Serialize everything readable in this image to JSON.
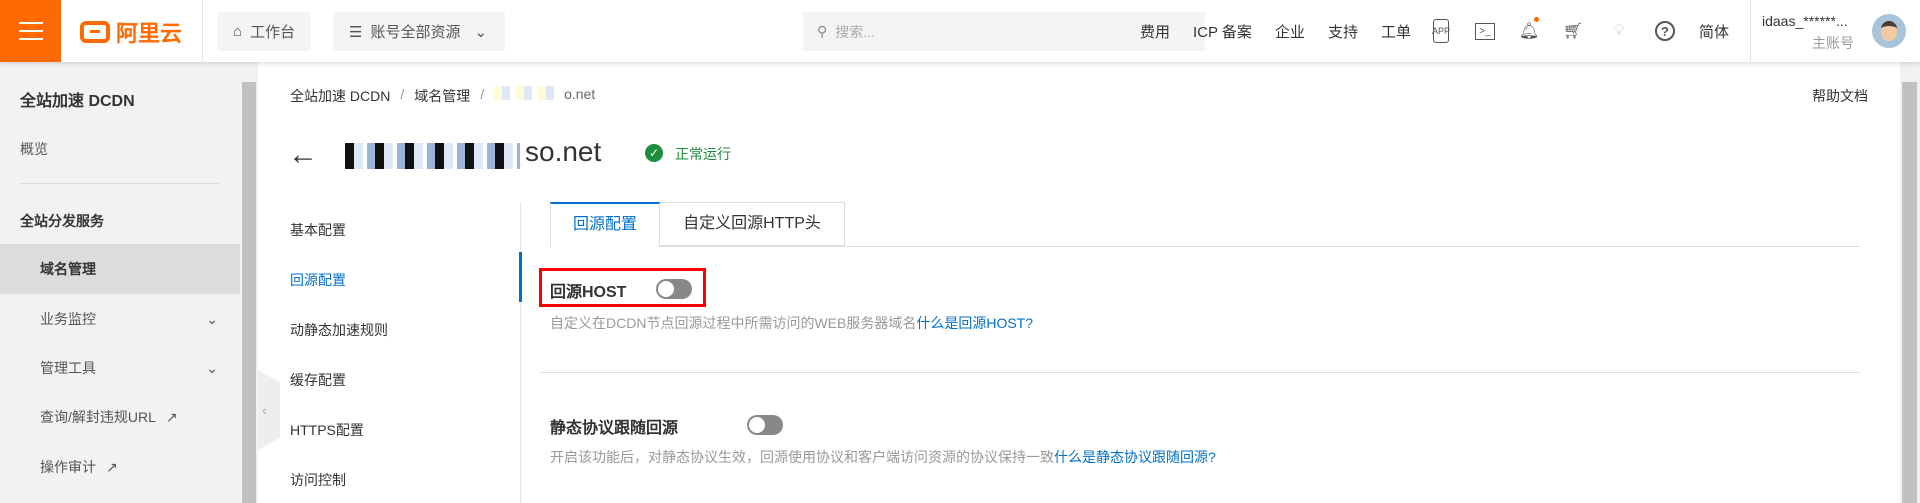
{
  "header": {
    "logo_text": "阿里云",
    "workbench": "工作台",
    "resources": "账号全部资源",
    "search_placeholder": "搜索...",
    "nav": [
      "费用",
      "ICP 备案",
      "企业",
      "支持",
      "工单"
    ],
    "icons": [
      "app-icon",
      "terminal-icon",
      "bell-icon",
      "cart-icon",
      "bulb-icon",
      "help-icon"
    ],
    "language": "简体",
    "username": "idaas_******...",
    "account_type": "主账号",
    "brand_color": "#ff6a00"
  },
  "sidebar": {
    "title": "全站加速 DCDN",
    "overview": "概览",
    "section": "全站分发服务",
    "items": [
      {
        "label": "域名管理",
        "active": true
      },
      {
        "label": "业务监控",
        "chevron": true
      },
      {
        "label": "管理工具",
        "chevron": true
      },
      {
        "label": "查询/解封违规URL",
        "external": true
      },
      {
        "label": "操作审计",
        "external": true
      }
    ]
  },
  "breadcrumb": [
    "全站加速 DCDN",
    "域名管理",
    "o.net"
  ],
  "help_doc": "帮助文档",
  "domain": {
    "name": "so.net",
    "status": "正常运行",
    "status_color": "#1e8e3e"
  },
  "subnav": [
    {
      "label": "基本配置"
    },
    {
      "label": "回源配置",
      "active": true
    },
    {
      "label": "动静态加速规则"
    },
    {
      "label": "缓存配置"
    },
    {
      "label": "HTTPS配置"
    },
    {
      "label": "访问控制"
    }
  ],
  "tabs": [
    {
      "label": "回源配置",
      "active": true
    },
    {
      "label": "自定义回源HTTP头"
    }
  ],
  "settings": [
    {
      "title": "回源HOST",
      "enabled": false,
      "desc": "自定义在DCDN节点回源过程中所需访问的WEB服务器域名",
      "link": "什么是回源HOST?"
    },
    {
      "title": "静态协议跟随回源",
      "enabled": false,
      "desc": "开启该功能后，对静态协议生效，回源使用协议和客户端访问资源的协议保持一致",
      "link": "什么是静态协议跟随回源?"
    }
  ],
  "accent_color": "#0070cc"
}
